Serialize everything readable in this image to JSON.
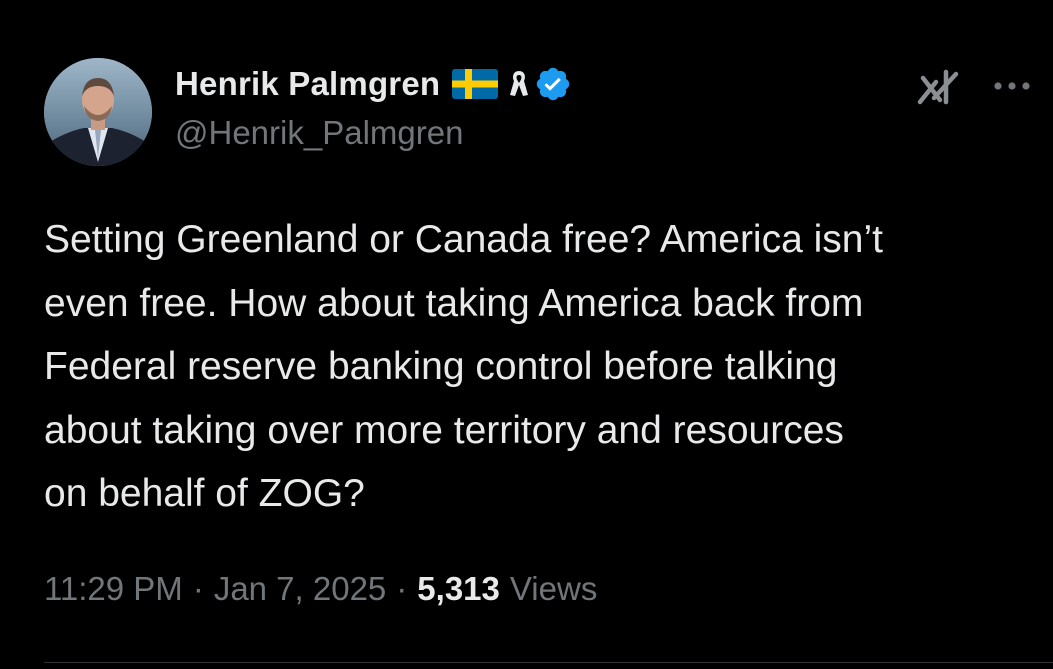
{
  "author": {
    "display_name": "Henrik Palmgren",
    "handle": "@Henrik_Palmgren",
    "badges": [
      "sweden-flag-icon",
      "ribbon-icon",
      "verified-badge-icon"
    ]
  },
  "tweet": {
    "text_lines": [
      "Setting Greenland or Canada free? America isn’t",
      "even free. How about taking America back from",
      "Federal reserve banking control before talking",
      "about taking over more territory and resources",
      "on behalf of ZOG?"
    ]
  },
  "meta": {
    "time": "11:29 PM",
    "separator": "·",
    "date": "Jan 7, 2025",
    "views_count": "5,313",
    "views_label": "Views"
  },
  "icons": {
    "grok": "grok-icon",
    "more": "more-options-icon"
  },
  "colors": {
    "background": "#000000",
    "text_primary": "#e7e9ea",
    "text_secondary": "#71767b",
    "verified_blue": "#1d9bf0",
    "flag_blue": "#006aa7",
    "flag_yellow": "#fecc00",
    "divider": "#2f3336"
  }
}
